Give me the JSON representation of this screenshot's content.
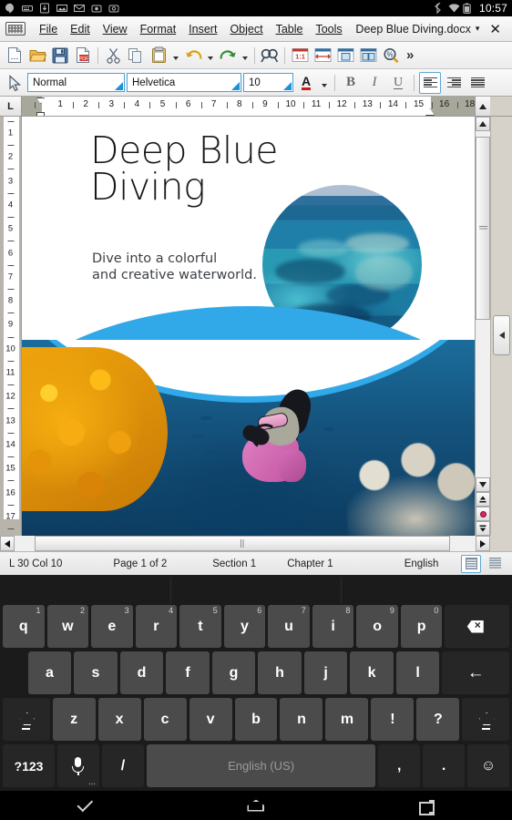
{
  "android_status": {
    "left_icons": [
      "hangouts-icon",
      "keyboard-icon",
      "download-icon",
      "screenshot-icon",
      "gmail-icon",
      "app-icon-1",
      "app-icon-2"
    ],
    "right_icons": [
      "bluetooth-icon",
      "wifi-icon",
      "battery-icon"
    ],
    "clock": "10:57"
  },
  "menubar": {
    "keyboard_toggle": "keyboard-icon",
    "items": [
      "File",
      "Edit",
      "View",
      "Format",
      "Insert",
      "Object",
      "Table",
      "Tools"
    ],
    "document_name": "Deep Blue Diving.docx",
    "caret": "▾",
    "close": "✕"
  },
  "toolbar1": {
    "buttons": [
      "new-document-icon",
      "open-folder-icon",
      "save-icon",
      "export-pdf-icon",
      "cut-icon",
      "copy-icon",
      "paste-icon",
      "paste-dropdown-icon",
      "undo-icon",
      "undo-dropdown-icon",
      "redo-icon",
      "redo-dropdown-icon",
      "find-replace-icon",
      "zoom-100-icon",
      "page-width-icon",
      "whole-page-icon",
      "two-pages-icon",
      "zoom-icon"
    ],
    "overflow": "»"
  },
  "toolbar2": {
    "select_tool": "cursor-arrow-icon",
    "paragraph_style": "Normal",
    "font_name": "Helvetica",
    "font_size": "10",
    "font_color": "A",
    "font_color_hex": "#d81616",
    "bold": "B",
    "italic": "I",
    "underline": "U",
    "align_left": "align-left-icon",
    "align_right": "align-right-icon",
    "align_justify": "align-justify-icon",
    "active_alignment": "align_left"
  },
  "ruler": {
    "corner_label": "L",
    "horizontal_numbers": [
      "1",
      "2",
      "3",
      "4",
      "5",
      "6",
      "7",
      "8",
      "9",
      "10",
      "11",
      "12",
      "13",
      "14",
      "15",
      "16",
      "18"
    ],
    "vertical_numbers": [
      "1",
      "2",
      "3",
      "4",
      "5",
      "6",
      "7",
      "8",
      "9",
      "10",
      "11",
      "12",
      "13",
      "14",
      "15",
      "16",
      "17"
    ]
  },
  "document": {
    "title": "Deep Blue\nDiving",
    "subtitle": "Dive into a colorful\nand creative waterworld.",
    "image_circle": "aerial-coral-reef-photo",
    "image_bottom": "underwater-scuba-diver-photo",
    "accent_color": "#31a8e8"
  },
  "status_bar": {
    "cursor": "L 30 Col 10",
    "page": "Page 1 of 2",
    "section": "Section 1",
    "chapter": "Chapter 1",
    "language": "English",
    "view_single": "single-page-view-icon",
    "view_multi": "multi-page-view-icon",
    "active_view": "view_single"
  },
  "keyboard": {
    "row1": [
      {
        "key": "q",
        "sup": "1"
      },
      {
        "key": "w",
        "sup": "2"
      },
      {
        "key": "e",
        "sup": "3"
      },
      {
        "key": "r",
        "sup": "4"
      },
      {
        "key": "t",
        "sup": "5"
      },
      {
        "key": "y",
        "sup": "6"
      },
      {
        "key": "u",
        "sup": "7"
      },
      {
        "key": "i",
        "sup": "8"
      },
      {
        "key": "o",
        "sup": "9"
      },
      {
        "key": "p",
        "sup": "0"
      }
    ],
    "backspace": "backspace-icon",
    "row2": [
      "a",
      "s",
      "d",
      "f",
      "g",
      "h",
      "j",
      "k",
      "l"
    ],
    "enter": "enter-icon",
    "row3": [
      "z",
      "x",
      "c",
      "v",
      "b",
      "n",
      "m",
      "!",
      "?"
    ],
    "shift_left": "shift-icon",
    "shift_right": "shift-icon",
    "symbols": "?123",
    "mic": "microphone-icon",
    "slash": "/",
    "space_label": "English (US)",
    "comma": ",",
    "period": ".",
    "emoji": "☺"
  },
  "navbar": {
    "back": "hide-keyboard-chevron-icon",
    "home": "home-icon",
    "recents": "recent-apps-icon"
  }
}
